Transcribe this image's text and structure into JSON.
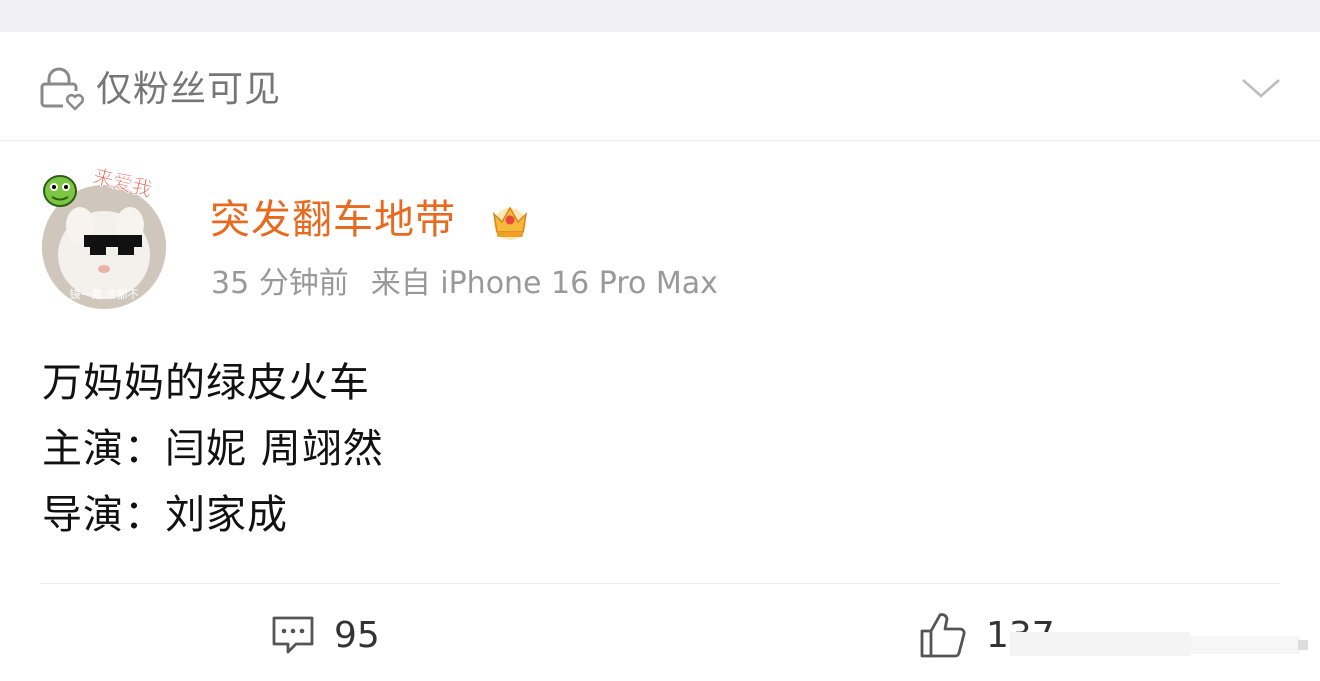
{
  "visibility": {
    "label": "仅粉丝可见"
  },
  "post": {
    "author": "突发翻车地带",
    "time": "35 分钟前",
    "source": "来自 iPhone 16 Pro Max",
    "lines": [
      "万妈妈的绿皮火车",
      "主演：闫妮 周翊然",
      "导演：刘家成"
    ]
  },
  "actions": {
    "comments": "95",
    "likes": "137"
  },
  "avatar": {
    "sticker_text": "来爱我",
    "caption": "镜一戴 谁都不"
  },
  "colors": {
    "username": "#e86a1e",
    "meta": "#999999",
    "muted": "#777777",
    "strip": "#f1f1f3"
  }
}
